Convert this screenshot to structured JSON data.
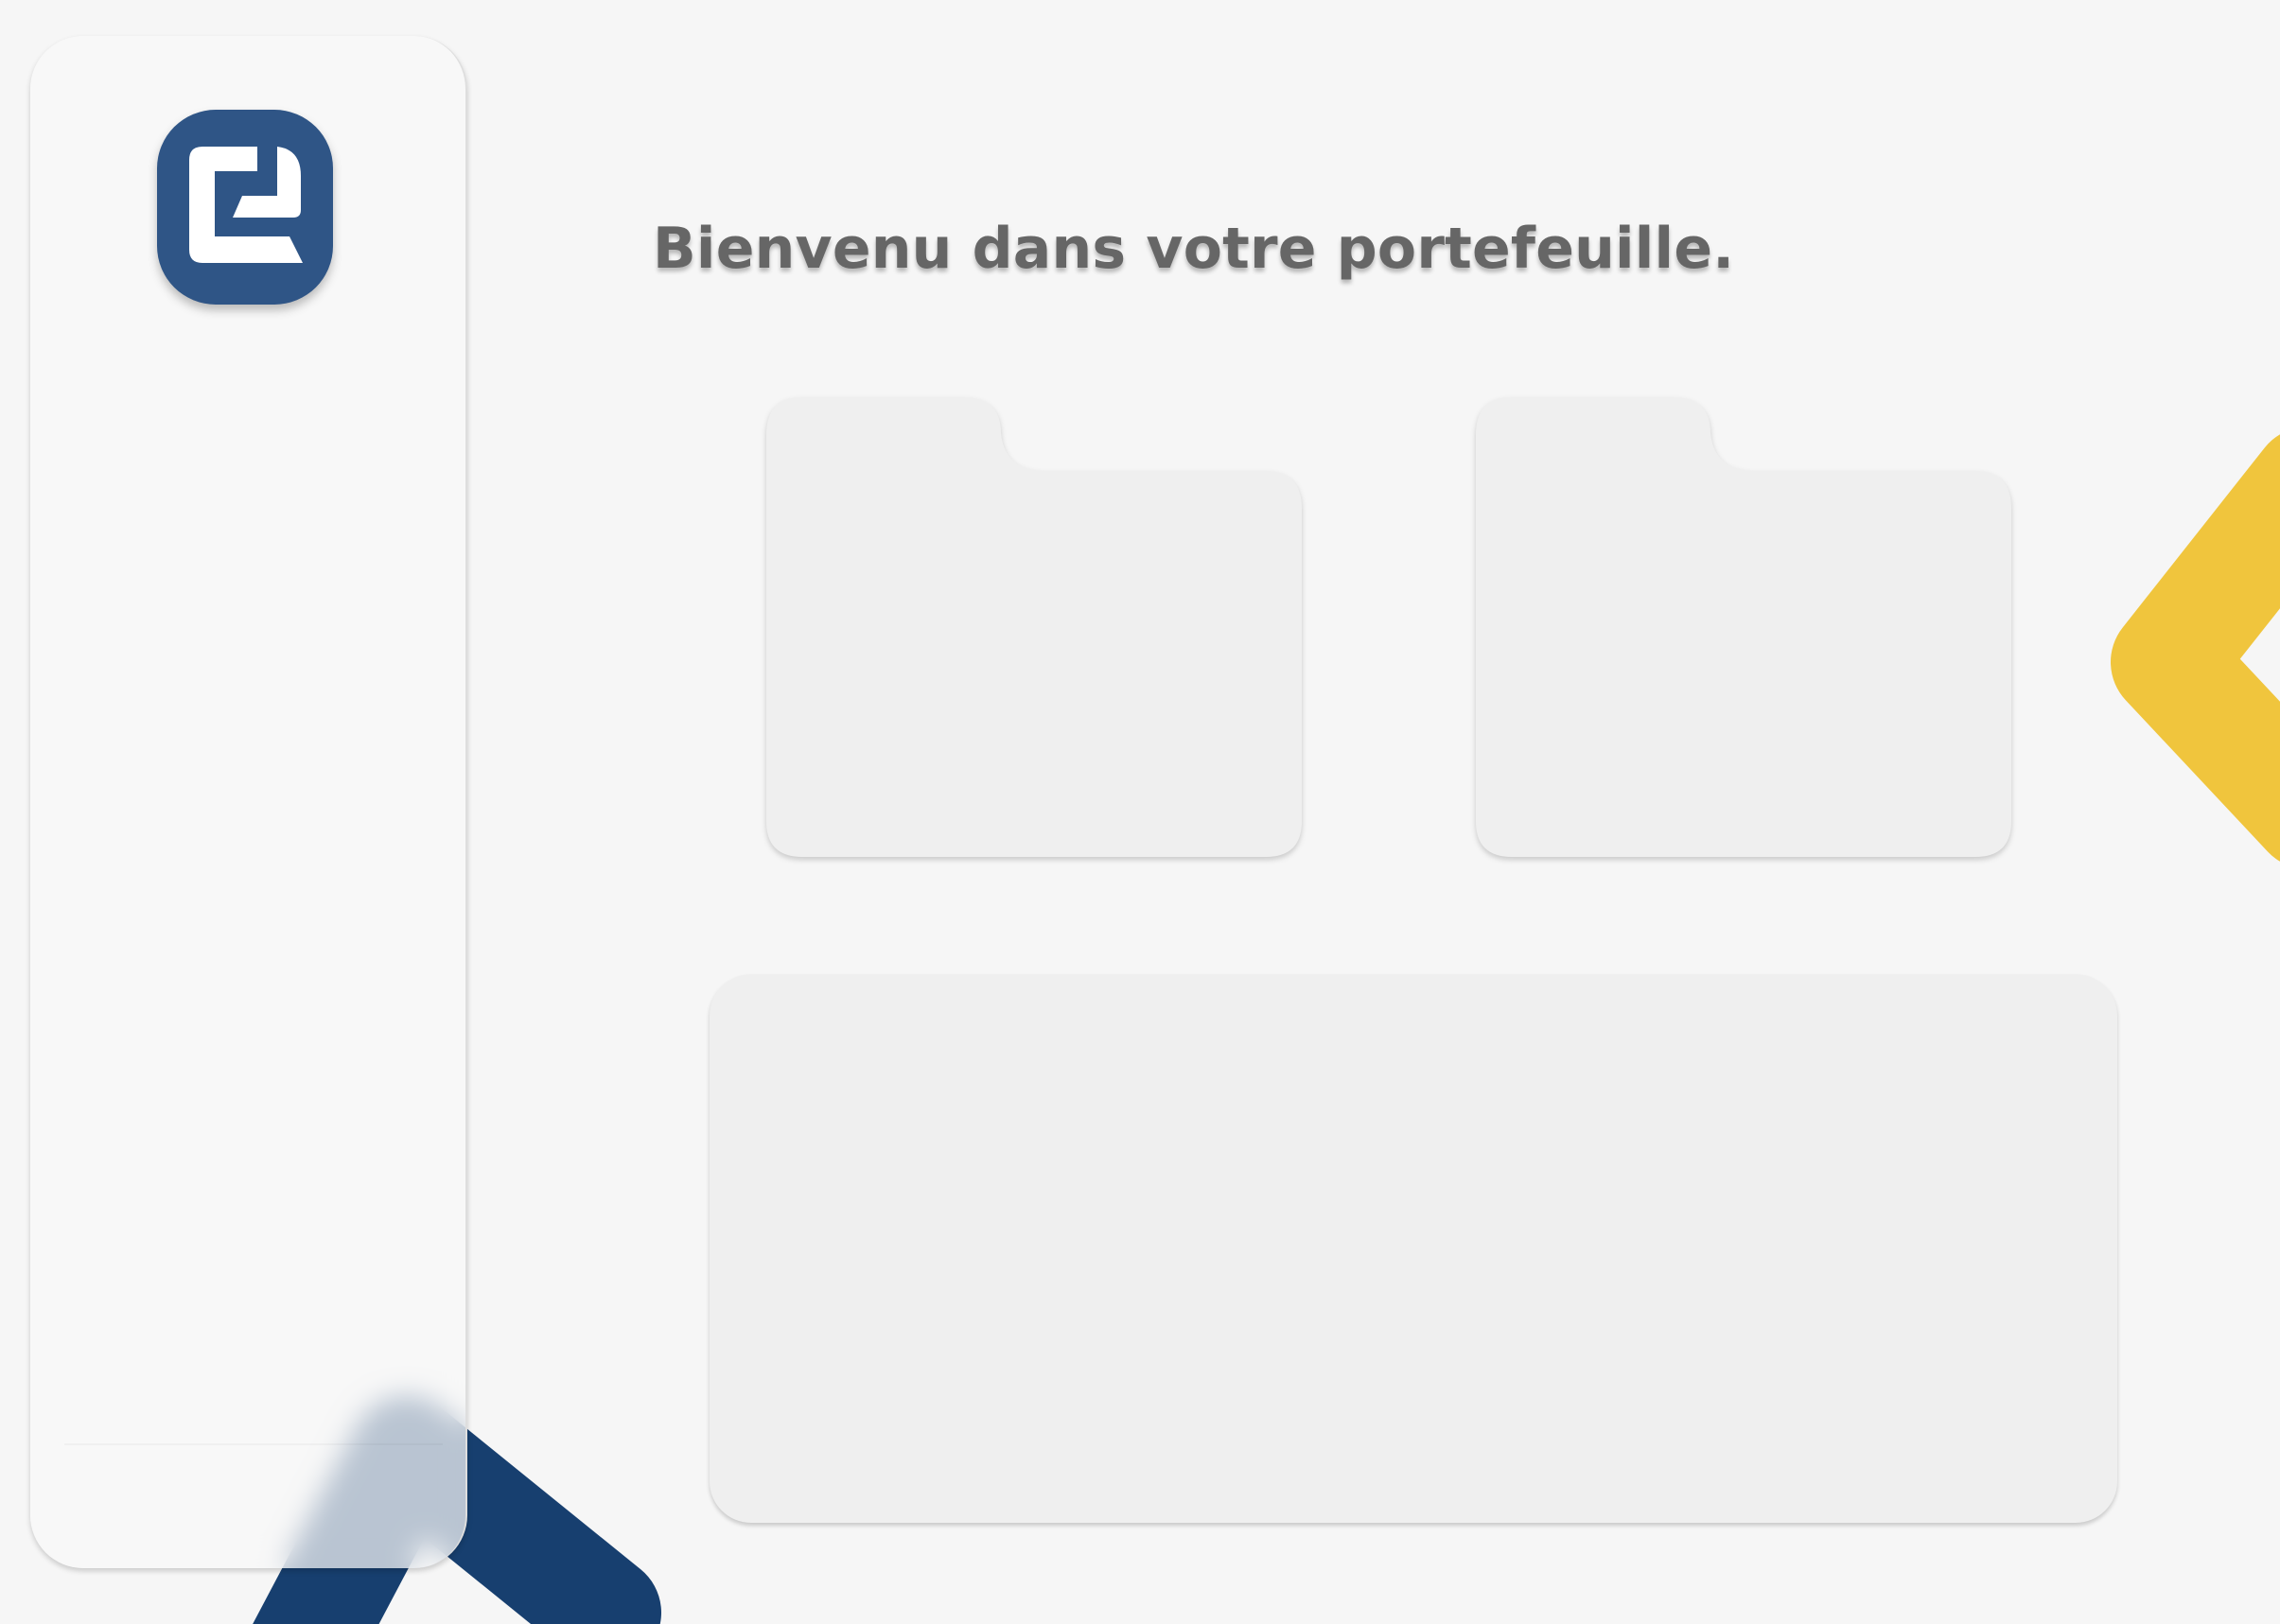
{
  "header": {
    "title": "Bienvenu dans votre portefeuille."
  },
  "sidebar": {
    "logo_icon": "wallet-logo-icon"
  },
  "folders": [
    {
      "icon": "folder-card"
    },
    {
      "icon": "folder-card"
    }
  ],
  "colors": {
    "logo_blue": "#2f5586",
    "accent_yellow": "#f0c53d",
    "accent_navy": "#173f6f",
    "card_background": "#efefef",
    "page_background": "#f6f6f6",
    "title_text": "#666666"
  }
}
